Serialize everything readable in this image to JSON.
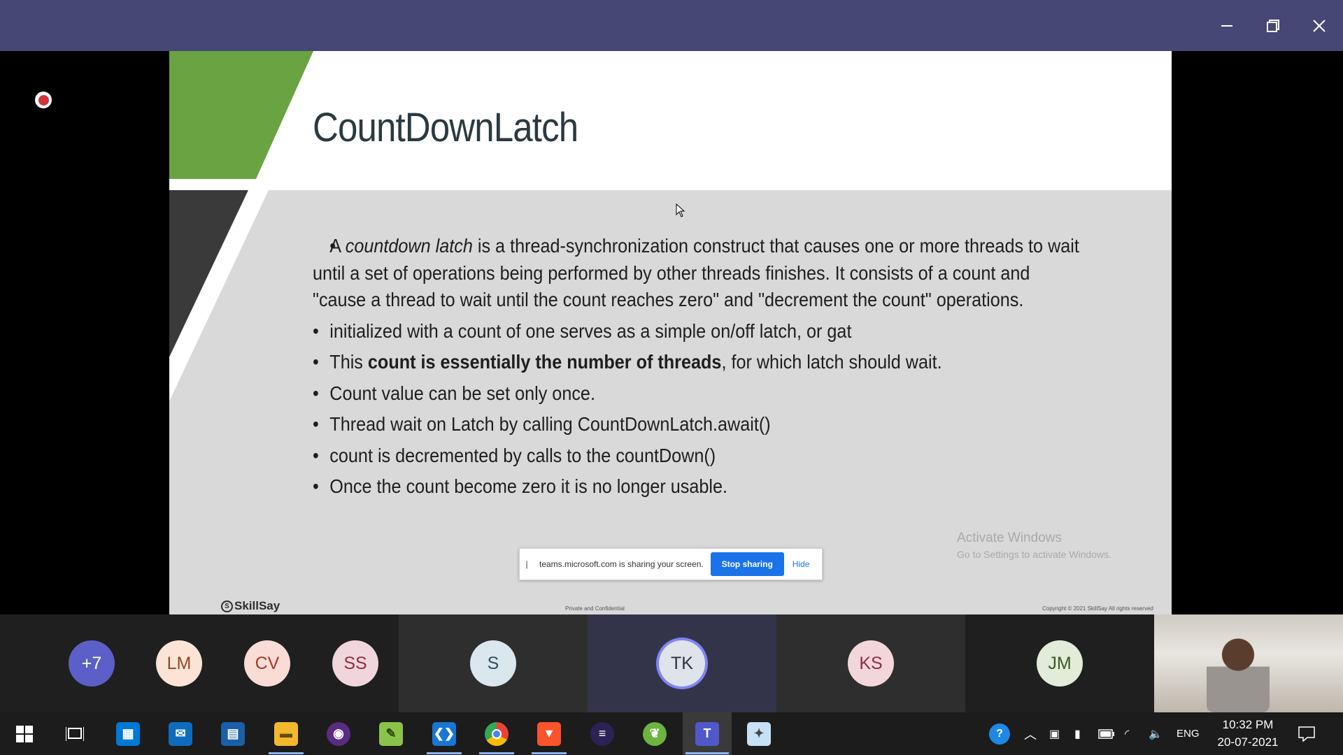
{
  "window": {
    "minimize_glyph": "—",
    "maximize_glyph": "❐",
    "close_glyph": "✕"
  },
  "slide": {
    "title": "CountDownLatch",
    "bullets": [
      {
        "parts": [
          "A ",
          "countdown latch",
          " is a thread-synchronization construct that causes one or more threads to wait until a set of operations being performed by other threads finishes. It consists of a count and \"cause a thread to wait until the count reaches zero\" and \"decrement the count\" operations."
        ]
      },
      {
        "text": "initialized with a count of one serves as a simple on/off latch, or gat"
      },
      {
        "parts": [
          "This ",
          "count is essentially the number of threads",
          ", for which latch should wait."
        ]
      },
      {
        "text": "Count value can be set only once."
      },
      {
        "text": "Thread wait on Latch by calling CountDownLatch.await()"
      },
      {
        "text": "count is decremented by calls to the countDown()"
      },
      {
        "text": "Once the count become zero it is no longer usable."
      }
    ],
    "brand": "SkillSay",
    "footer_center": "Private and Confidential",
    "footer_right": "Copyright © 2021 SkillSay All rights reserved"
  },
  "activation": {
    "line1": "Activate Windows",
    "line2": "Go to Settings to activate Windows."
  },
  "share_bar": {
    "message": "teams.microsoft.com is sharing your screen.",
    "stop_label": "Stop sharing",
    "hide_label": "Hide"
  },
  "participants": [
    {
      "initials": "+7",
      "bg": "#5b5fc7",
      "fg": "#ffffff"
    },
    {
      "initials": "LM",
      "bg": "#fbe4d5",
      "fg": "#8c4a2f"
    },
    {
      "initials": "CV",
      "bg": "#f9dcd6",
      "fg": "#a33b2b"
    },
    {
      "initials": "SS",
      "bg": "#f0d6dc",
      "fg": "#8a2f45"
    },
    {
      "initials": "S",
      "bg": "#dbe7ee",
      "fg": "#2d4f63"
    },
    {
      "initials": "TK",
      "bg": "#dfe3ea",
      "fg": "#2e3340",
      "speaking": true
    },
    {
      "initials": "KS",
      "bg": "#f3d6dc",
      "fg": "#8a2f45"
    },
    {
      "initials": "JM",
      "bg": "#e3ecd8",
      "fg": "#3c5a26"
    }
  ],
  "tray": {
    "language": "ENG",
    "time": "10:32 PM",
    "date": "20-07-2021"
  },
  "colors": {
    "titlebar": "#464775",
    "slide_green": "#6aa342",
    "slide_dark": "#3a3a3a",
    "share_button": "#1a73e8"
  }
}
